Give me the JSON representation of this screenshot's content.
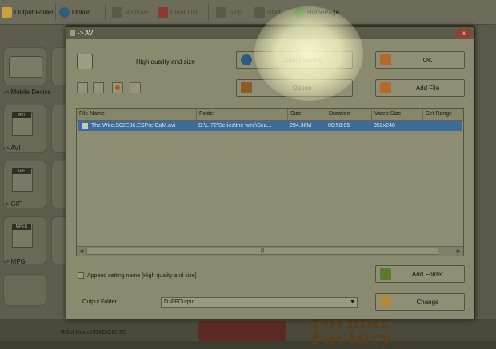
{
  "toolbar": {
    "items": [
      {
        "label": "Output Folder",
        "icon": "folder-icon",
        "color": "#c8a040"
      },
      {
        "label": "Option",
        "icon": "option-icon",
        "color": "#2f5d82"
      },
      {
        "label": "Remove",
        "icon": "remove-icon",
        "color": "#5a5a48"
      },
      {
        "label": "Clear List",
        "icon": "clear-list-icon",
        "color": "#8a3a30"
      },
      {
        "label": "Stop",
        "icon": "stop-icon",
        "color": "#5a5a48"
      },
      {
        "label": "Start",
        "icon": "start-icon",
        "color": "#5a5a48"
      },
      {
        "label": "HomePage",
        "icon": "homepage-icon",
        "color": "#3c7a2a"
      }
    ]
  },
  "left_panel": {
    "categories": [
      {
        "label": "-> Mobile Device"
      },
      {
        "label": "-> AVI",
        "tag": "AVI"
      },
      {
        "label": "-> GIF",
        "tag": "GIF"
      },
      {
        "label": "-> MPG",
        "tag": "MPEG"
      }
    ]
  },
  "dialog": {
    "title": "-> AVI",
    "close_label": "x",
    "quality_text": "High quality and size",
    "buttons": {
      "output_setting": "Output Setting",
      "ok": "OK",
      "option": "Option",
      "add_file": "Add File",
      "add_folder": "Add Folder",
      "change": "Change"
    },
    "table": {
      "columns": [
        "File Name",
        "Folder",
        "Size",
        "Duration",
        "Video Size",
        "Set Range"
      ],
      "rows": [
        [
          "The.Wire.S02E06.ESPre.CaM.avi",
          "D:\\L-72\\Series\\the wire\\Sea...",
          "294.36M",
          "00:58:05",
          "352x240",
          ""
        ]
      ]
    },
    "append_label": "Append setting name [High quality and size]",
    "append_checked": false,
    "output_folder_label": "Output Folder",
    "output_folder_value": "D:\\FFOutput"
  },
  "bottom": {
    "status_text": "ROM Device\\DVD\\CD\\ISO",
    "logo_text": "Format\nFactory"
  },
  "colors": {
    "selected_row": "#3d6c9a",
    "dialog_bg": "#8a8a70",
    "highlight": "#fffde0"
  }
}
